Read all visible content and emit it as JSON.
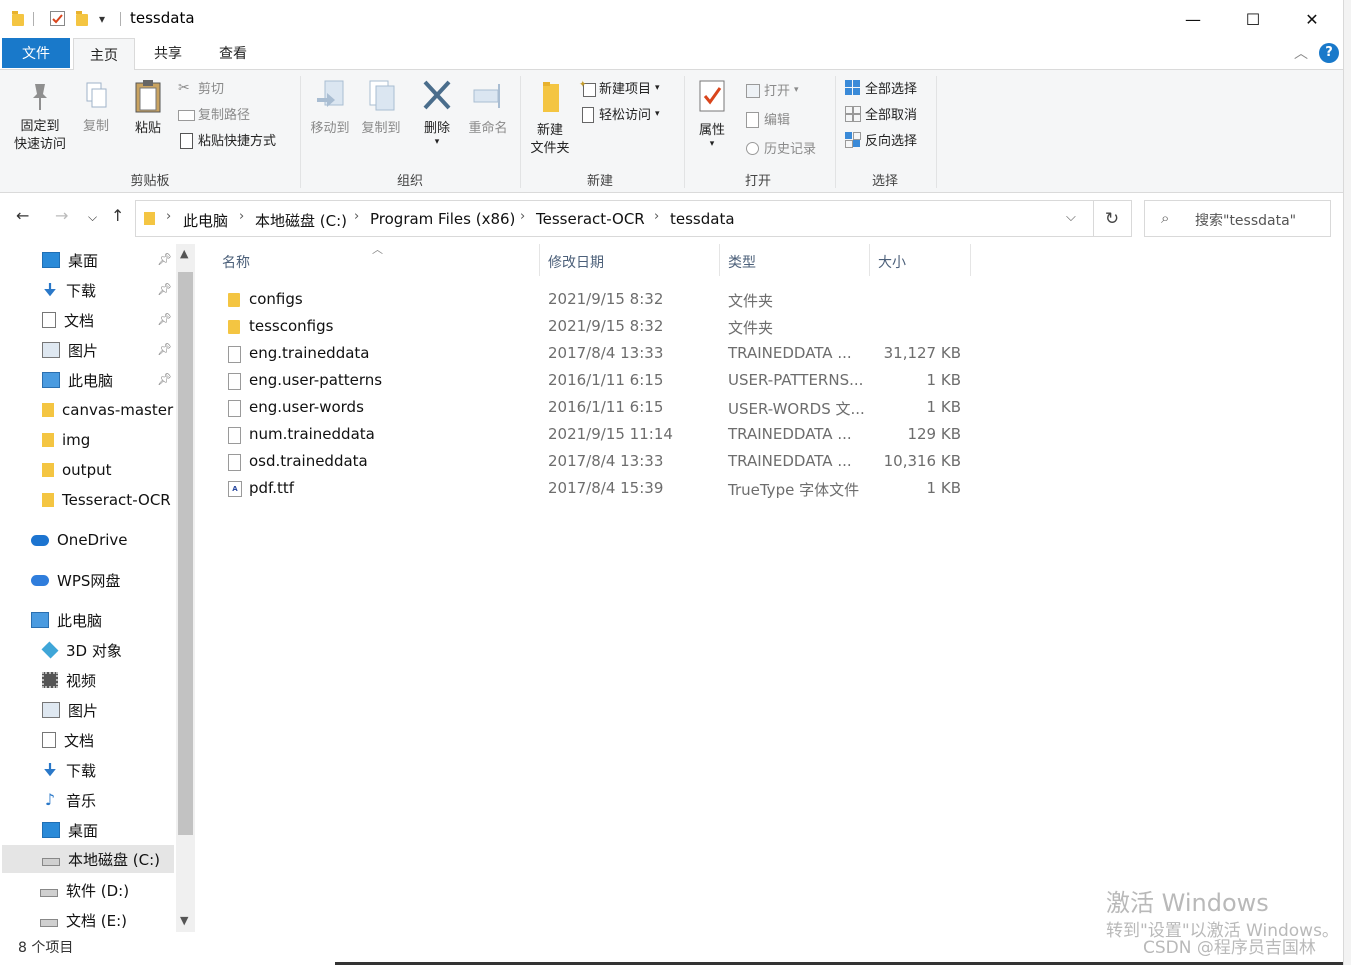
{
  "window": {
    "title": "tessdata",
    "minimize": "—",
    "maximize": "☐",
    "close": "✕"
  },
  "tabs": [
    {
      "label": "文件"
    },
    {
      "label": "主页"
    },
    {
      "label": "共享"
    },
    {
      "label": "查看"
    }
  ],
  "ribbon": {
    "clipboard": {
      "label": "剪贴板",
      "pin_line1": "固定到",
      "pin_line2": "快速访问",
      "copy": "复制",
      "paste": "粘贴",
      "cut": "剪切",
      "copy_path": "复制路径",
      "paste_shortcut": "粘贴快捷方式"
    },
    "organize": {
      "label": "组织",
      "move_to": "移动到",
      "copy_to": "复制到",
      "delete": "删除",
      "rename": "重命名"
    },
    "new": {
      "label": "新建",
      "new_folder_line1": "新建",
      "new_folder_line2": "文件夹",
      "new_item": "新建项目",
      "easy_access": "轻松访问"
    },
    "open": {
      "label": "打开",
      "properties": "属性",
      "open": "打开",
      "edit": "编辑",
      "history": "历史记录"
    },
    "select": {
      "label": "选择",
      "select_all": "全部选择",
      "select_none": "全部取消",
      "invert": "反向选择"
    }
  },
  "address": {
    "crumbs": [
      "此电脑",
      "本地磁盘 (C:)",
      "Program Files (x86)",
      "Tesseract-OCR",
      "tessdata"
    ],
    "search_placeholder": "搜索\"tessdata\""
  },
  "nav": {
    "quick": [
      {
        "label": "桌面",
        "icon": "desktop-icon"
      },
      {
        "label": "下载",
        "icon": "download-icon"
      },
      {
        "label": "文档",
        "icon": "document-icon"
      },
      {
        "label": "图片",
        "icon": "picture-icon"
      },
      {
        "label": "此电脑",
        "icon": "computer-icon"
      },
      {
        "label": "canvas-master",
        "icon": "folder-icon"
      },
      {
        "label": "img",
        "icon": "folder-icon"
      },
      {
        "label": "output",
        "icon": "folder-icon"
      },
      {
        "label": "Tesseract-OCR",
        "icon": "folder-icon"
      }
    ],
    "onedrive": "OneDrive",
    "wps": "WPS网盘",
    "thispc": "此电脑",
    "pc_items": [
      {
        "label": "3D 对象",
        "icon": "3d-objects-icon"
      },
      {
        "label": "视频",
        "icon": "video-icon"
      },
      {
        "label": "图片",
        "icon": "picture-icon"
      },
      {
        "label": "文档",
        "icon": "document-icon"
      },
      {
        "label": "下载",
        "icon": "download-icon"
      },
      {
        "label": "音乐",
        "icon": "music-icon"
      },
      {
        "label": "桌面",
        "icon": "desktop-icon"
      },
      {
        "label": "本地磁盘 (C:)",
        "icon": "drive-icon"
      },
      {
        "label": "软件 (D:)",
        "icon": "drive-icon"
      },
      {
        "label": "文档 (E:)",
        "icon": "drive-icon"
      }
    ]
  },
  "columns": {
    "name": "名称",
    "date": "修改日期",
    "type": "类型",
    "size": "大小"
  },
  "files": [
    {
      "name": "configs",
      "date": "2021/9/15 8:32",
      "type": "文件夹",
      "size": "",
      "kind": "folder"
    },
    {
      "name": "tessconfigs",
      "date": "2021/9/15 8:32",
      "type": "文件夹",
      "size": "",
      "kind": "folder"
    },
    {
      "name": "eng.traineddata",
      "date": "2017/8/4 13:33",
      "type": "TRAINEDDATA ...",
      "size": "31,127 KB",
      "kind": "file"
    },
    {
      "name": "eng.user-patterns",
      "date": "2016/1/11 6:15",
      "type": "USER-PATTERNS...",
      "size": "1 KB",
      "kind": "file"
    },
    {
      "name": "eng.user-words",
      "date": "2016/1/11 6:15",
      "type": "USER-WORDS 文...",
      "size": "1 KB",
      "kind": "file"
    },
    {
      "name": "num.traineddata",
      "date": "2021/9/15 11:14",
      "type": "TRAINEDDATA ...",
      "size": "129 KB",
      "kind": "file"
    },
    {
      "name": "osd.traineddata",
      "date": "2017/8/4 13:33",
      "type": "TRAINEDDATA ...",
      "size": "10,316 KB",
      "kind": "file"
    },
    {
      "name": "pdf.ttf",
      "date": "2017/8/4 15:39",
      "type": "TrueType 字体文件",
      "size": "1 KB",
      "kind": "ttf"
    }
  ],
  "status": {
    "count": "8 个项目"
  },
  "watermark": {
    "line1": "激活 Windows",
    "line2": "转到\"设置\"以激活 Windows。",
    "line3": "CSDN @程序员吉国林"
  }
}
